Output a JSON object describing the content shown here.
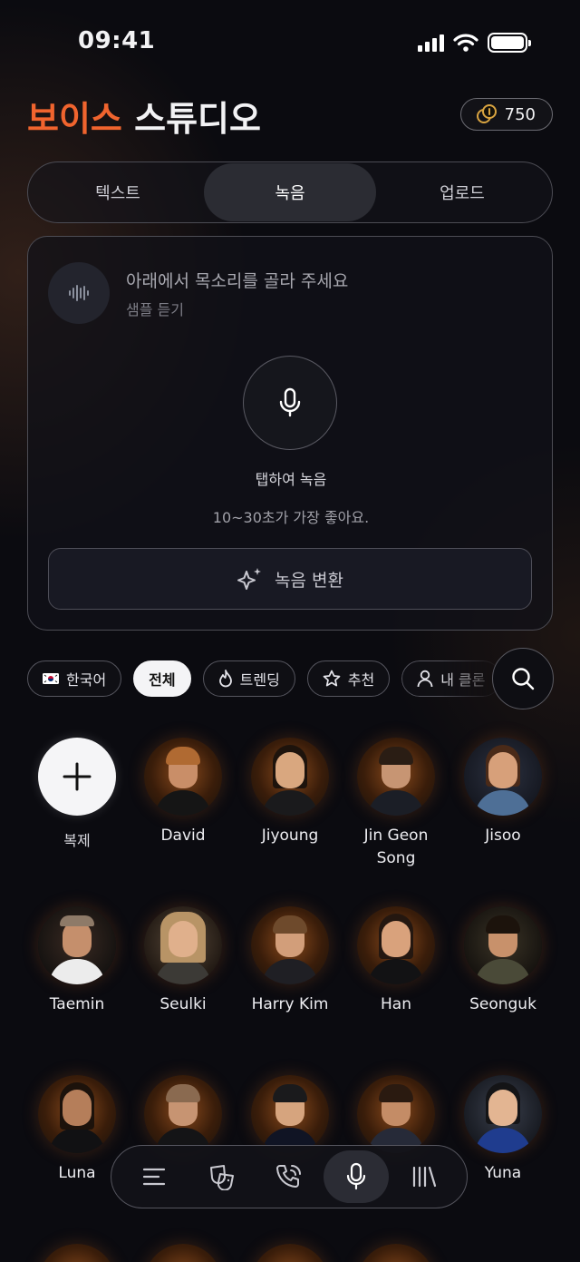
{
  "status": {
    "time": "09:41"
  },
  "header": {
    "title_accent": "보이스",
    "title_rest": "스튜디오",
    "credits": "750"
  },
  "tabs": [
    {
      "label": "텍스트",
      "active": false
    },
    {
      "label": "녹음",
      "active": true
    },
    {
      "label": "업로드",
      "active": false
    }
  ],
  "record_card": {
    "sample_title": "아래에서 목소리를 골라 주세요",
    "sample_subtitle": "샘플 듣기",
    "tap_label": "탭하여 녹음",
    "hint": "10~30초가 가장 좋아요.",
    "convert_label": "녹음 변환"
  },
  "filters": [
    {
      "label": "한국어",
      "icon": "korea-flag-icon",
      "active": false
    },
    {
      "label": "전체",
      "icon": "",
      "active": true
    },
    {
      "label": "트렌딩",
      "icon": "flame-icon",
      "active": false
    },
    {
      "label": "추천",
      "icon": "star-icon",
      "active": false
    },
    {
      "label": "내 클론",
      "icon": "person-icon",
      "active": false
    }
  ],
  "clone": {
    "label": "복제"
  },
  "voices": [
    {
      "name": "David"
    },
    {
      "name": "Jiyoung"
    },
    {
      "name": "Jin Geon Song"
    },
    {
      "name": "Jisoo"
    },
    {
      "name": "Taemin"
    },
    {
      "name": "Seulki"
    },
    {
      "name": "Harry Kim"
    },
    {
      "name": "Han"
    },
    {
      "name": "Seonguk"
    },
    {
      "name": "Luna"
    },
    {
      "name": ""
    },
    {
      "name": ""
    },
    {
      "name": ""
    },
    {
      "name": "Yuna"
    }
  ],
  "bottom_nav": [
    {
      "icon": "menu-icon",
      "active": false
    },
    {
      "icon": "theater-mask-icon",
      "active": false
    },
    {
      "icon": "phone-call-icon",
      "active": false
    },
    {
      "icon": "microphone-icon",
      "active": true
    },
    {
      "icon": "library-icon",
      "active": false
    }
  ],
  "colors": {
    "accent": "#f0642e",
    "background": "#0b0b10",
    "gold": "#d9a441"
  }
}
